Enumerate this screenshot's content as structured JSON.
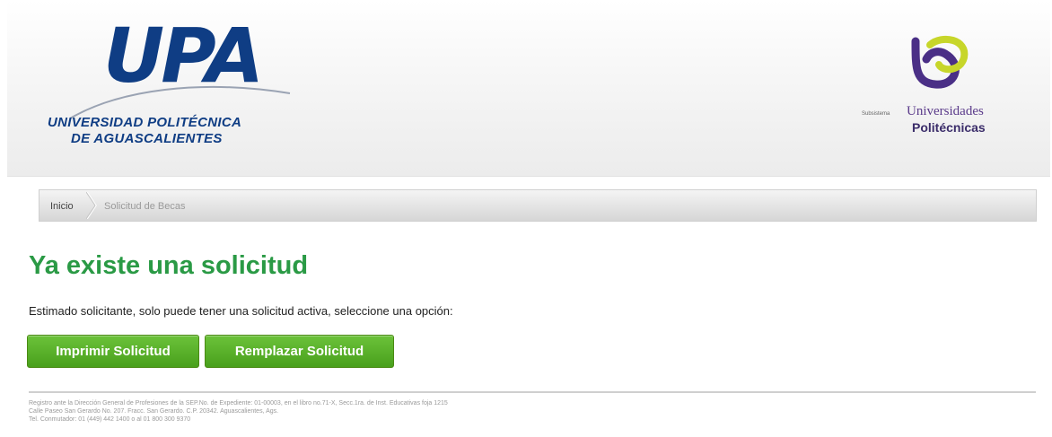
{
  "header": {
    "upa_logo": {
      "letters": "UPA",
      "name_line1": "UNIVERSIDAD POLITÉCNICA",
      "name_line2": "DE AGUASCALIENTES"
    },
    "up_logo": {
      "line1": "Universidades",
      "line2": "Politécnicas",
      "small_text": "Subsistema",
      "icon": "universidades-politecnicas-mark-icon"
    }
  },
  "breadcrumb": {
    "home": "Inicio",
    "current": "Solicitud de Becas"
  },
  "main": {
    "title": "Ya existe una solicitud",
    "message": "Estimado solicitante, solo puede tener una solicitud activa, seleccione una opción:",
    "buttons": {
      "print": "Imprimir Solicitud",
      "replace": "Remplazar Solicitud"
    }
  },
  "footer": {
    "line1": "Registro ante la Dirección General de Profesiones de la SEP.No. de Expediente: 01-00003, en el libro no.71-X, Secc.1ra. de Inst. Educativas foja 1215",
    "line2": "Calle Paseo San Gerardo No. 207. Fracc. San Gerardo. C.P. 20342. Aguascalientes, Ags.",
    "line3": "Tel. Conmutador: 01 (449) 442 1400 o al 01 800 300 9370"
  },
  "colors": {
    "brand_blue": "#0f3d84",
    "title_green": "#2a9a45",
    "button_green": "#55ad25",
    "up_purple": "#5a3a8a",
    "up_yellow": "#c7d62a"
  }
}
